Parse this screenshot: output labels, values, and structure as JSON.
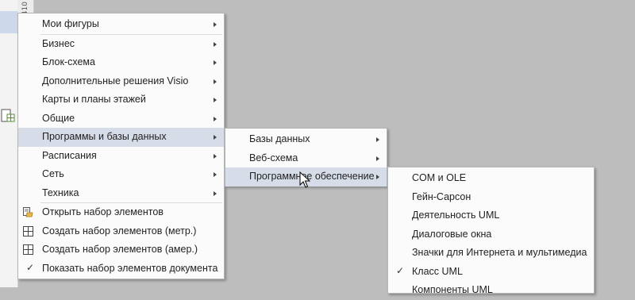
{
  "background_color": "#bdbdbd",
  "ruler_label": "410",
  "menu_main": {
    "items": [
      {
        "label": "Мои фигуры",
        "submenu": true
      },
      {
        "label": "Бизнес",
        "submenu": true
      },
      {
        "label": "Блок-схема",
        "submenu": true
      },
      {
        "label": "Дополнительные решения Visio",
        "submenu": true
      },
      {
        "label": "Карты и планы этажей",
        "submenu": true
      },
      {
        "label": "Общие",
        "submenu": true
      },
      {
        "label": "Программы и базы данных",
        "submenu": true,
        "highlighted": true
      },
      {
        "label": "Расписания",
        "submenu": true
      },
      {
        "label": "Сеть",
        "submenu": true
      },
      {
        "label": "Техника",
        "submenu": true
      }
    ],
    "commands": [
      {
        "label": "Открыть набор элементов",
        "icon": "open-stencil-icon"
      },
      {
        "label": "Создать набор элементов (метр.)",
        "icon": "new-stencil-icon"
      },
      {
        "label": "Создать набор элементов (амер.)",
        "icon": "new-stencil-icon"
      },
      {
        "label": "Показать набор элементов документа",
        "icon": "check-icon",
        "checked": true
      }
    ]
  },
  "menu_software": {
    "items": [
      {
        "label": "Базы данных",
        "submenu": true
      },
      {
        "label": "Веб-схема",
        "submenu": true
      },
      {
        "label": "Программное обеспечение",
        "submenu": true,
        "highlighted": true
      }
    ]
  },
  "menu_programs": {
    "items": [
      {
        "label": "COM и OLE"
      },
      {
        "label": "Гейн-Сарсон"
      },
      {
        "label": "Деятельность UML"
      },
      {
        "label": "Диалоговые окна"
      },
      {
        "label": "Значки для Интернета и мультимедиа"
      },
      {
        "label": "Класс UML",
        "checked": true
      },
      {
        "label": "Компоненты UML"
      }
    ]
  },
  "check_glyph": "✓",
  "highlight_color": "#d6dde8"
}
